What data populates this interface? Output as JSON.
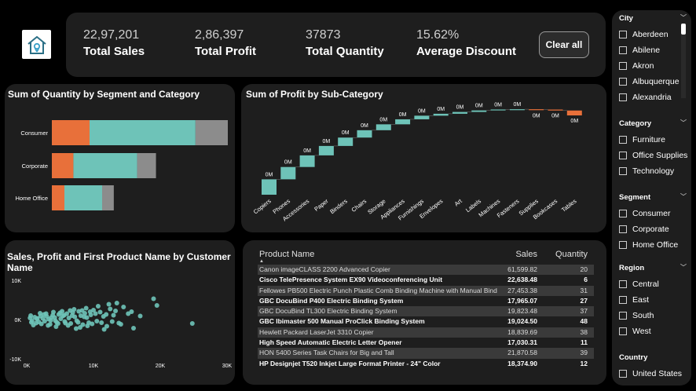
{
  "kpis": [
    {
      "value": "22,97,201",
      "label": "Total Sales"
    },
    {
      "value": "2,86,397",
      "label": "Total Profit"
    },
    {
      "value": "37873",
      "label": "Total Quantity"
    },
    {
      "value": "15.62%",
      "label": "Average Discount"
    }
  ],
  "clear_button": "Clear all",
  "titles": {
    "quantity_chart": "Sum of Quantity by Segment and Category",
    "profit_chart": "Sum of Profit by Sub-Category",
    "scatter_chart": "Sales, Profit and First Product Name by Customer Name"
  },
  "colors": {
    "orange": "#e8703a",
    "teal": "#6ec3b8",
    "gray": "#8c8c8c",
    "negative": "#e8703a"
  },
  "chart_data": [
    {
      "type": "bar",
      "orientation": "horizontal",
      "stacked": true,
      "title": "Sum of Quantity by Segment and Category",
      "categories": [
        "Consumer",
        "Corporate",
        "Home Office"
      ],
      "series": [
        {
          "name": "Furniture",
          "values": [
            4200,
            2400,
            1400
          ]
        },
        {
          "name": "Office Supplies",
          "values": [
            11800,
            7100,
            4200
          ]
        },
        {
          "name": "Technology",
          "values": [
            3600,
            2100,
            1300
          ]
        }
      ]
    },
    {
      "type": "bar",
      "subtype": "waterfall",
      "title": "Sum of Profit by Sub-Category",
      "categories": [
        "Copiers",
        "Phones",
        "Accessories",
        "Paper",
        "Binders",
        "Chairs",
        "Storage",
        "Appliances",
        "Furnishings",
        "Envelopes",
        "Art",
        "Labels",
        "Machines",
        "Fasteners",
        "Supplies",
        "Bookcases",
        "Tables"
      ],
      "values": [
        55618,
        44516,
        41937,
        34054,
        30222,
        26590,
        21279,
        18138,
        13059,
        6964,
        6528,
        5546,
        3385,
        950,
        -1189,
        -3473,
        -17725
      ],
      "data_labels": [
        "0M",
        "0M",
        "0M",
        "0M",
        "0M",
        "0M",
        "0M",
        "0M",
        "0M",
        "0M",
        "0M",
        "0M",
        "0M",
        "0M",
        "0M",
        "0M",
        "0M"
      ]
    },
    {
      "type": "scatter",
      "title": "Sales, Profit and First Product Name by Customer Name",
      "x_ticks": [
        "0K",
        "10K",
        "20K",
        "30K"
      ],
      "y_ticks": [
        "10K",
        "0K",
        "-10K"
      ],
      "xlim": [
        0,
        30000
      ],
      "ylim": [
        -10000,
        10000
      ],
      "points": [
        [
          500,
          400
        ],
        [
          800,
          -300
        ],
        [
          1200,
          600
        ],
        [
          1500,
          200
        ],
        [
          1800,
          -600
        ],
        [
          2100,
          900
        ],
        [
          2400,
          300
        ],
        [
          2700,
          -400
        ],
        [
          3000,
          800
        ],
        [
          3300,
          100
        ],
        [
          3600,
          -200
        ],
        [
          3900,
          1100
        ],
        [
          4200,
          500
        ],
        [
          4500,
          -700
        ],
        [
          4800,
          1300
        ],
        [
          5100,
          200
        ],
        [
          5400,
          900
        ],
        [
          5700,
          -500
        ],
        [
          6000,
          1500
        ],
        [
          6300,
          400
        ],
        [
          6600,
          -1000
        ],
        [
          6900,
          1800
        ],
        [
          7200,
          700
        ],
        [
          7500,
          -300
        ],
        [
          7800,
          2100
        ],
        [
          8100,
          1000
        ],
        [
          8400,
          -1300
        ],
        [
          8700,
          1600
        ],
        [
          9000,
          500
        ],
        [
          9300,
          -800
        ],
        [
          9600,
          1200
        ],
        [
          10000,
          2400
        ],
        [
          10500,
          -400
        ],
        [
          11000,
          1900
        ],
        [
          11500,
          800
        ],
        [
          12000,
          -1700
        ],
        [
          12500,
          2700
        ],
        [
          13000,
          1100
        ],
        [
          13800,
          -900
        ],
        [
          14500,
          3200
        ],
        [
          15200,
          1500
        ],
        [
          16000,
          -2200
        ],
        [
          17000,
          900
        ],
        [
          19000,
          5300
        ],
        [
          19500,
          3600
        ],
        [
          24800,
          -1000
        ],
        [
          1000,
          -1400
        ],
        [
          2000,
          1600
        ],
        [
          3500,
          -1200
        ],
        [
          4400,
          -1800
        ],
        [
          5300,
          2100
        ],
        [
          6200,
          -1500
        ],
        [
          7100,
          2600
        ],
        [
          8000,
          -2000
        ],
        [
          8900,
          2900
        ],
        [
          9800,
          -1100
        ],
        [
          10700,
          3400
        ],
        [
          11600,
          -2500
        ],
        [
          12300,
          3900
        ],
        [
          13500,
          4200
        ],
        [
          600,
          1000
        ],
        [
          1400,
          -900
        ],
        [
          2600,
          1300
        ],
        [
          3200,
          -1500
        ],
        [
          4000,
          1900
        ],
        [
          4700,
          -1000
        ],
        [
          5600,
          1100
        ],
        [
          6500,
          2300
        ],
        [
          7400,
          -2300
        ],
        [
          8300,
          2300
        ],
        [
          9100,
          -1600
        ],
        [
          10300,
          1500
        ],
        [
          11200,
          -800
        ],
        [
          11900,
          1300
        ],
        [
          12800,
          -500
        ],
        [
          13300,
          2200
        ],
        [
          14100,
          -1200
        ],
        [
          15700,
          2000
        ],
        [
          700,
          -700
        ],
        [
          1600,
          300
        ],
        [
          2200,
          -1100
        ],
        [
          2900,
          1500
        ],
        [
          3700,
          500
        ],
        [
          4300,
          -300
        ],
        [
          5000,
          1700
        ],
        [
          5800,
          -900
        ],
        [
          6800,
          1000
        ],
        [
          7700,
          -700
        ],
        [
          8600,
          700
        ],
        [
          9500,
          2000
        ]
      ]
    }
  ],
  "table": {
    "headers": {
      "name": "Product Name",
      "sales": "Sales",
      "quantity": "Quantity"
    },
    "rows": [
      {
        "name": "Canon imageCLASS 2200 Advanced Copier",
        "sales": "61,599.82",
        "quantity": "20"
      },
      {
        "name": "Cisco TelePresence System EX90 Videoconferencing Unit",
        "sales": "22,638.48",
        "quantity": "6"
      },
      {
        "name": "Fellowes PB500 Electric Punch Plastic Comb Binding Machine with Manual Bind",
        "sales": "27,453.38",
        "quantity": "31"
      },
      {
        "name": "GBC DocuBind P400 Electric Binding System",
        "sales": "17,965.07",
        "quantity": "27"
      },
      {
        "name": "GBC DocuBind TL300 Electric Binding System",
        "sales": "19,823.48",
        "quantity": "37"
      },
      {
        "name": "GBC Ibimaster 500 Manual ProClick Binding System",
        "sales": "19,024.50",
        "quantity": "48"
      },
      {
        "name": "Hewlett Packard LaserJet 3310 Copier",
        "sales": "18,839.69",
        "quantity": "38"
      },
      {
        "name": "High Speed Automatic Electric Letter Opener",
        "sales": "17,030.31",
        "quantity": "11"
      },
      {
        "name": "HON 5400 Series Task Chairs for Big and Tall",
        "sales": "21,870.58",
        "quantity": "39"
      },
      {
        "name": "HP Designjet T520 Inkjet Large Format Printer - 24\" Color",
        "sales": "18,374.90",
        "quantity": "12"
      }
    ]
  },
  "slicers": [
    {
      "title": "City",
      "items": [
        "Aberdeen",
        "Abilene",
        "Akron",
        "Albuquerque",
        "Alexandria"
      ]
    },
    {
      "title": "Category",
      "items": [
        "Furniture",
        "Office Supplies",
        "Technology"
      ]
    },
    {
      "title": "Segment",
      "items": [
        "Consumer",
        "Corporate",
        "Home Office"
      ]
    },
    {
      "title": "Region",
      "items": [
        "Central",
        "East",
        "South",
        "West"
      ]
    },
    {
      "title": "Country",
      "items": [
        "United States"
      ]
    }
  ]
}
